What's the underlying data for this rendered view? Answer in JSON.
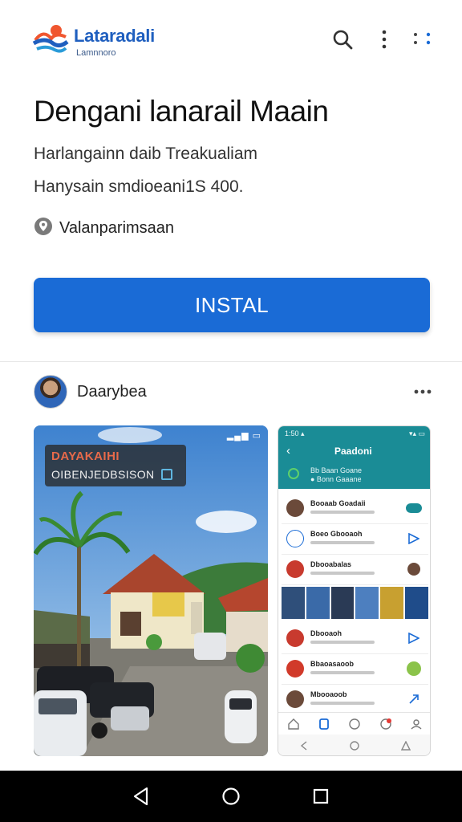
{
  "app": {
    "brand": "Lataradali",
    "brand_sub": "Lamnnoro",
    "title": "Dengani lanarail Maain",
    "subtitle_1": "Harlangainn daib Treakualiam",
    "subtitle_2": "Hanysain smdioeani1S 400.",
    "location": "Valanparimsaan",
    "install_label": "INSTAL"
  },
  "icons": {
    "logo": "brand-logo",
    "search": "search-icon",
    "more_vertical": "more-vertical-icon",
    "grid_dots": "dots-grid-icon",
    "location": "location-pin-icon",
    "more_horizontal": "more-horizontal-icon"
  },
  "developer": {
    "name": "Daarybea"
  },
  "screenshot_1": {
    "status": "▂▄▆ ▭",
    "banner_line_1": "DAYAKAIHI",
    "banner_line_2": "OIBENJEDBSISON"
  },
  "screenshot_2": {
    "status_left": "1:50 ▴",
    "status_right": "▾▴ ▭",
    "header_title": "Paadoni",
    "header_sub_1": "Bb Baan Goane",
    "header_sub_2": "● Bonn Gaaane",
    "rows": [
      {
        "name": "Booaab Goadaii"
      },
      {
        "name": "Boeo Gbooaoh"
      },
      {
        "name": "Dbooabalas"
      },
      {
        "name": "Dbooaoh"
      },
      {
        "name": "Bbaoasaoob"
      },
      {
        "name": "Mbooaoob"
      }
    ]
  },
  "colors": {
    "accent": "#1a6bd6",
    "brand": "#1f5fbf",
    "teal": "#1a8c96"
  }
}
